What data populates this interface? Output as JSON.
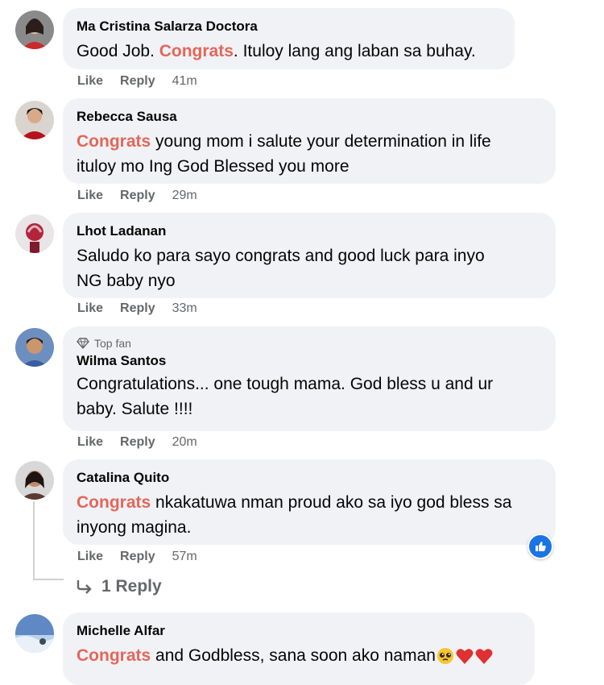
{
  "comments": [
    {
      "author": "Ma Cristina Salarza Doctora",
      "text_parts": [
        "Good Job. ",
        "Congrats",
        ". Ituloy lang ang laban sa buhay."
      ],
      "like": "Like",
      "reply": "Reply",
      "time": "41m"
    },
    {
      "author": "Rebecca Sausa",
      "text_parts": [
        "Congrats",
        " young mom i salute your determination in life",
        "ituloy mo Ing God Blessed you more"
      ],
      "like": "Like",
      "reply": "Reply",
      "time": "29m"
    },
    {
      "author": "Lhot Ladanan",
      "text_parts": [
        "Saludo ko para sayo congrats and good luck para inyo",
        "NG baby nyo"
      ],
      "like": "Like",
      "reply": "Reply",
      "time": "33m"
    },
    {
      "badge": "Top fan",
      "author": "Wilma Santos",
      "text_parts": [
        "Congratulations... one tough mama. God bless u and ur",
        "baby. Salute !!!!"
      ],
      "like": "Like",
      "reply": "Reply",
      "time": "20m"
    },
    {
      "author": "Catalina Quito",
      "text_parts": [
        "Congrats",
        " nkakatuwa nman proud ako sa iyo god bless sa",
        "inyong magina."
      ],
      "like": "Like",
      "reply": "Reply",
      "time": "57m",
      "reaction_icon": "like-reaction-icon"
    },
    {
      "author": "Michelle Alfar",
      "text_parts": [
        "Congrats",
        " and Godbless, sana soon ako naman"
      ],
      "emoji_icons": [
        "pleading-face-icon",
        "red-heart-icon",
        "red-heart-icon"
      ]
    }
  ],
  "replies_link": "1 Reply",
  "colors": {
    "highlight": "#e4665a",
    "bubble": "#f0f2f5",
    "secondary_text": "#65676b",
    "like_blue": "#1b74e4"
  }
}
